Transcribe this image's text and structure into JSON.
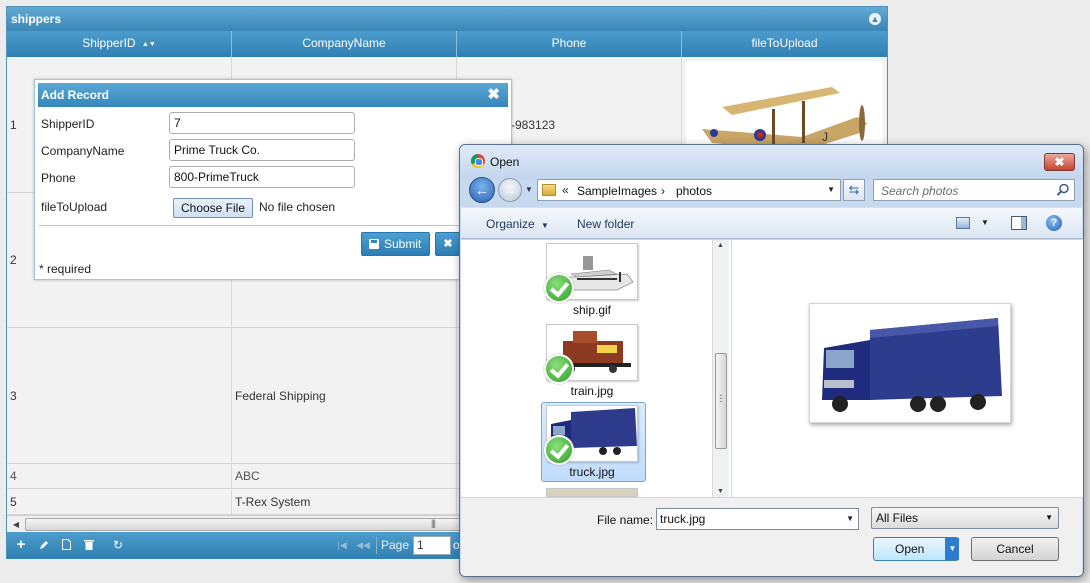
{
  "grid": {
    "title": "shippers",
    "columns": [
      "ShipperID",
      "CompanyName",
      "Phone",
      "fileToUpload"
    ],
    "sort_indicator": "▲▼",
    "rows": [
      {
        "id": "1",
        "company": "",
        "phone": "-983123"
      },
      {
        "id": "2",
        "company": "",
        "phone": ""
      },
      {
        "id": "3",
        "company": "Federal Shipping",
        "phone": ""
      },
      {
        "id": "4",
        "company": "ABC",
        "phone": ""
      },
      {
        "id": "5",
        "company": "T-Rex System",
        "phone": ""
      }
    ],
    "pager": {
      "page_label": "Page",
      "page_value": "1",
      "page_tail": "o",
      "icons": [
        "plus-icon",
        "pencil-icon",
        "document-icon",
        "trash-icon",
        "refresh-icon"
      ]
    }
  },
  "add_record": {
    "title": "Add Record",
    "close": "✖",
    "fields": [
      {
        "label": "ShipperID",
        "value": "7"
      },
      {
        "label": "CompanyName",
        "value": "Prime Truck Co."
      },
      {
        "label": "Phone",
        "value": "800-PrimeTruck"
      }
    ],
    "file_label": "fileToUpload",
    "choose_file": "Choose File",
    "no_file": "No file chosen",
    "submit": "Submit",
    "cancel_icon": "✖",
    "required_note": "* required"
  },
  "open_dialog": {
    "title": "Open",
    "close": "✖",
    "address": {
      "chevrons": "«",
      "crumbs": [
        "SampleImages",
        "photos"
      ],
      "separator": "›"
    },
    "search_placeholder": "Search photos",
    "toolbar": {
      "organize": "Organize",
      "new_folder": "New folder",
      "help": "?"
    },
    "files": [
      {
        "name": "ship.gif"
      },
      {
        "name": "train.jpg"
      },
      {
        "name": "truck.jpg",
        "selected": true
      }
    ],
    "file_name_label": "File name:",
    "file_name_value": "truck.jpg",
    "filter": "All Files",
    "open_button": "Open",
    "cancel_button": "Cancel"
  },
  "colors": {
    "grid_header": "#3a87b8",
    "selection": "#c1dcfc",
    "check": "#2d9f27"
  }
}
